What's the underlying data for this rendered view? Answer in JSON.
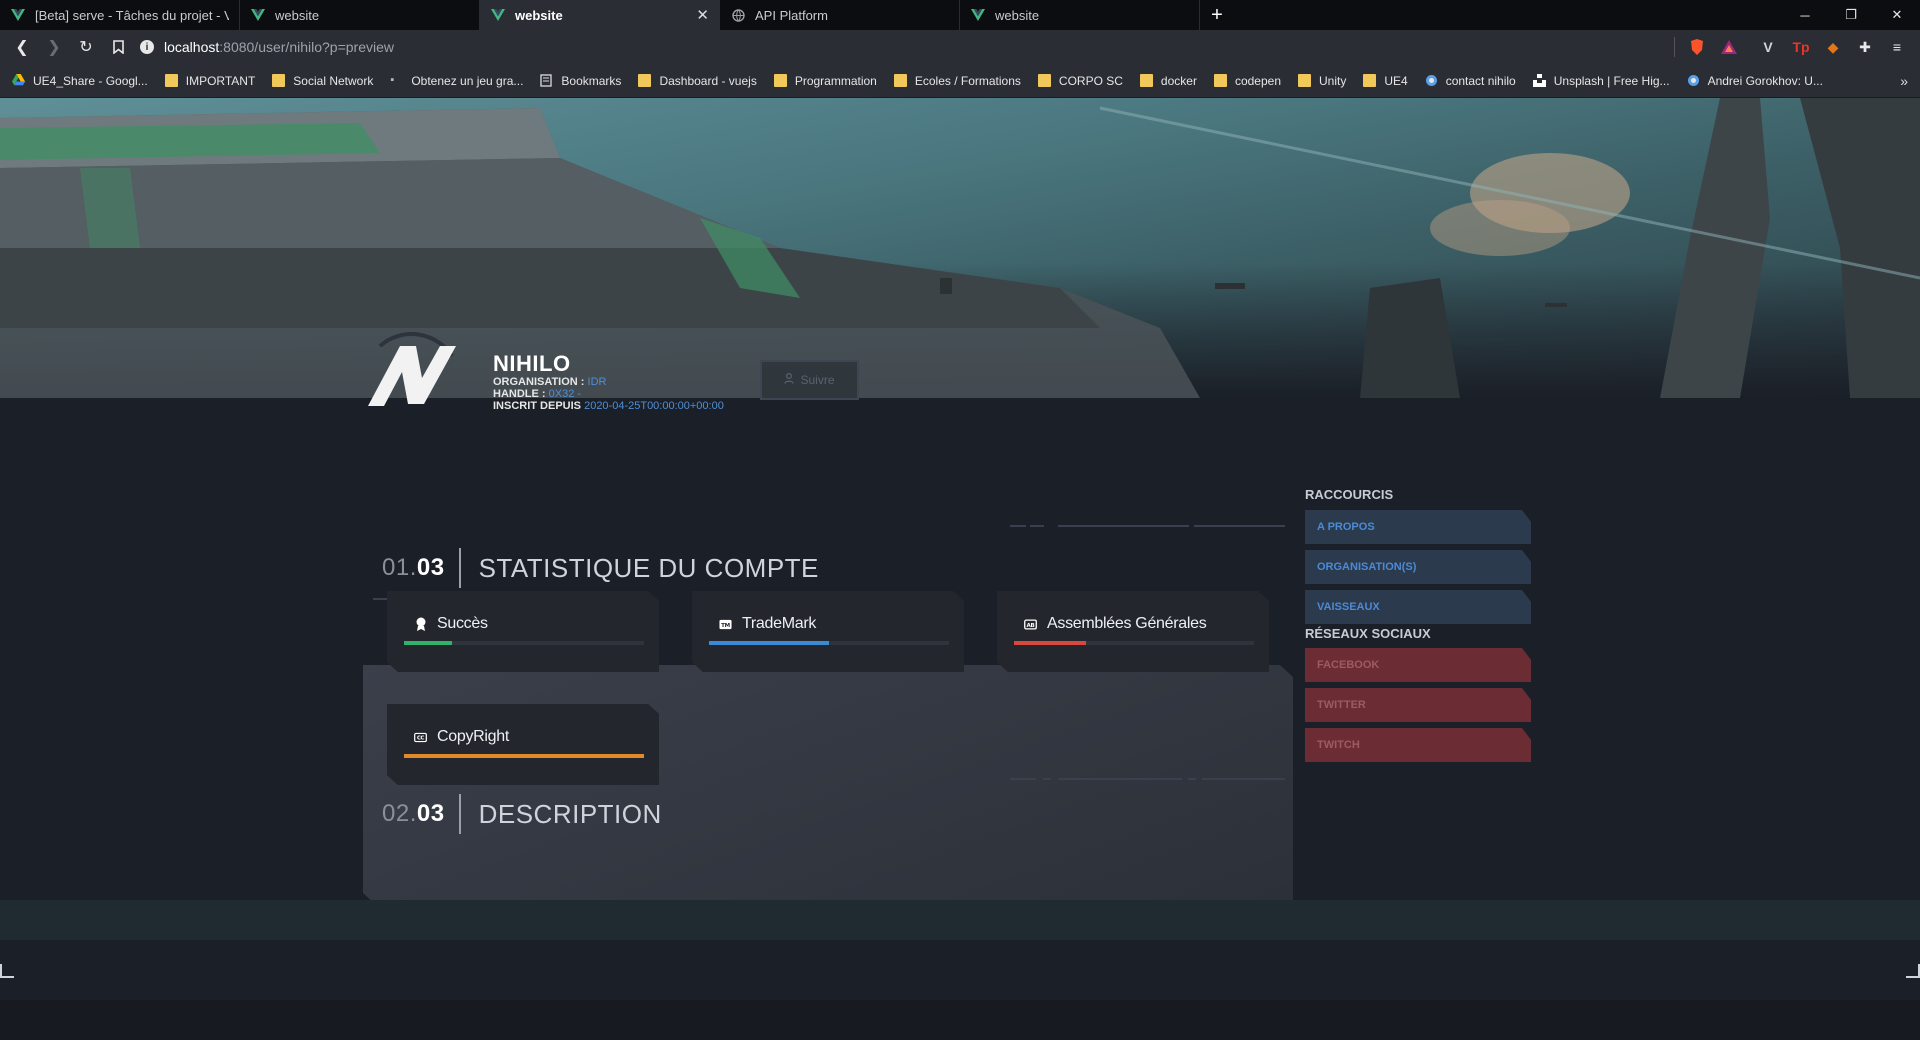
{
  "browser": {
    "tabs": [
      {
        "title": "[Beta] serve - Tâches du projet - Vue C",
        "active": false,
        "icon": "vue-icon"
      },
      {
        "title": "website",
        "active": false,
        "icon": "vue-icon"
      },
      {
        "title": "website",
        "active": true,
        "icon": "vue-icon"
      },
      {
        "title": "API Platform",
        "active": false,
        "icon": "globe-icon"
      },
      {
        "title": "website",
        "active": false,
        "icon": "vue-icon"
      }
    ],
    "url_host": "localhost",
    "url_path": ":8080/user/nihilo?p=preview",
    "bookmarks": [
      {
        "label": "UE4_Share - Googl...",
        "icon": "google-drive-icon"
      },
      {
        "label": "IMPORTANT",
        "icon": "folder-icon"
      },
      {
        "label": "Social Network",
        "icon": "folder-icon"
      },
      {
        "label": "Obtenez un jeu gra...",
        "icon": "epic-icon"
      },
      {
        "label": "Bookmarks",
        "icon": "bookmark-page-icon"
      },
      {
        "label": "Dashboard - vuejs",
        "icon": "folder-icon"
      },
      {
        "label": "Programmation",
        "icon": "folder-icon"
      },
      {
        "label": "Ecoles / Formations",
        "icon": "folder-icon"
      },
      {
        "label": "CORPO SC",
        "icon": "folder-icon"
      },
      {
        "label": "docker",
        "icon": "folder-icon"
      },
      {
        "label": "codepen",
        "icon": "folder-icon"
      },
      {
        "label": "Unity",
        "icon": "folder-icon"
      },
      {
        "label": "UE4",
        "icon": "folder-icon"
      },
      {
        "label": "contact nihilo",
        "icon": "site-icon"
      },
      {
        "label": "Unsplash | Free Hig...",
        "icon": "unsplash-icon"
      },
      {
        "label": "Andrei Gorokhov: U...",
        "icon": "site-icon"
      }
    ],
    "bookmarks_more": "»"
  },
  "profile": {
    "name": "NIHILO",
    "org_label": "ORGANISATION :",
    "org_value": "IDR",
    "handle_label": "HANDLE :",
    "handle_value": "0X32 -",
    "since_label": "INSCRIT DEPUIS",
    "since_value": "2020-04-25T00:00:00+00:00",
    "follow_label": "Suivre"
  },
  "section_stats": {
    "num_prefix": "01.",
    "num_bold": "03",
    "title": "STATISTIQUE DU COMPTE"
  },
  "section_desc": {
    "num_prefix": "02.",
    "num_bold": "03",
    "title": "DESCRIPTION"
  },
  "stats": [
    {
      "label": "Succès",
      "icon": "medal-icon",
      "progress": 0.2,
      "color": "#2fb36a"
    },
    {
      "label": "TradeMark",
      "icon": "trademark-icon",
      "progress": 0.5,
      "color": "#3a8ad6"
    },
    {
      "label": "Assemblées Générales",
      "icon": "ag-icon",
      "progress": 0.3,
      "color": "#d8483e"
    },
    {
      "label": "CopyRight",
      "icon": "copyright-icon",
      "progress": 1.0,
      "color": "#e08a2c"
    }
  ],
  "sidebar": {
    "shortcuts_title": "RACCOURCIS",
    "shortcuts": [
      "A PROPOS",
      "ORGANISATION(S)",
      "VAISSEAUX"
    ],
    "social_title": "RÉSEAUX SOCIAUX",
    "social": [
      "FACEBOOK",
      "TWITTER",
      "TWITCH"
    ]
  },
  "colors": {
    "accent_blue": "#4f8fd6",
    "social_red": "#6b2c33",
    "shortcut_blue": "#2b3a4d"
  }
}
